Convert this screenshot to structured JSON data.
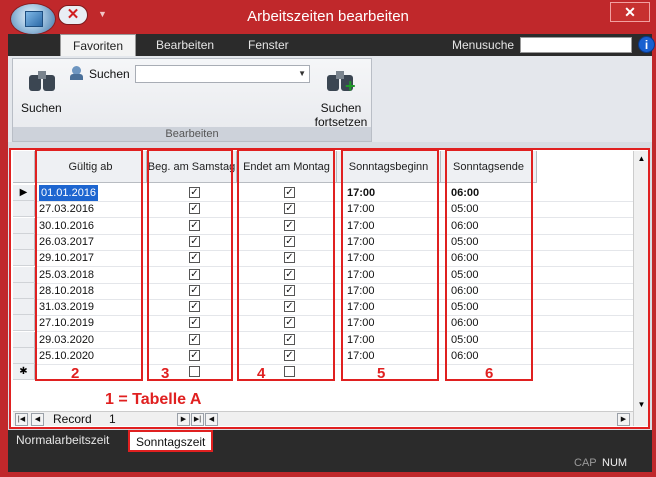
{
  "window": {
    "title": "Arbeitszeiten bearbeiten",
    "close": "✕"
  },
  "ribbon": {
    "tabs": [
      "Favoriten",
      "Bearbeiten",
      "Fenster"
    ],
    "menusuche_label": "Menusuche",
    "help": "i",
    "group": {
      "label": "Bearbeiten",
      "search_big": "Suchen",
      "search_small": "Suchen",
      "search_next": [
        "Suchen",
        "fortsetzen"
      ]
    }
  },
  "grid": {
    "columns": [
      "Gültig ab",
      "Beg. am Samstag",
      "Endet am Montag",
      "Sonntagsbeginn",
      "Sonntagsende"
    ],
    "rows": [
      {
        "valid_from": "01.01.2016",
        "beg_sat": true,
        "end_mon": true,
        "sun_start": "17:00",
        "sun_end": "06:00"
      },
      {
        "valid_from": "27.03.2016",
        "beg_sat": true,
        "end_mon": true,
        "sun_start": "17:00",
        "sun_end": "05:00"
      },
      {
        "valid_from": "30.10.2016",
        "beg_sat": true,
        "end_mon": true,
        "sun_start": "17:00",
        "sun_end": "06:00"
      },
      {
        "valid_from": "26.03.2017",
        "beg_sat": true,
        "end_mon": true,
        "sun_start": "17:00",
        "sun_end": "05:00"
      },
      {
        "valid_from": "29.10.2017",
        "beg_sat": true,
        "end_mon": true,
        "sun_start": "17:00",
        "sun_end": "06:00"
      },
      {
        "valid_from": "25.03.2018",
        "beg_sat": true,
        "end_mon": true,
        "sun_start": "17:00",
        "sun_end": "05:00"
      },
      {
        "valid_from": "28.10.2018",
        "beg_sat": true,
        "end_mon": true,
        "sun_start": "17:00",
        "sun_end": "06:00"
      },
      {
        "valid_from": "31.03.2019",
        "beg_sat": true,
        "end_mon": true,
        "sun_start": "17:00",
        "sun_end": "05:00"
      },
      {
        "valid_from": "27.10.2019",
        "beg_sat": true,
        "end_mon": true,
        "sun_start": "17:00",
        "sun_end": "06:00"
      },
      {
        "valid_from": "29.03.2020",
        "beg_sat": true,
        "end_mon": true,
        "sun_start": "17:00",
        "sun_end": "05:00"
      },
      {
        "valid_from": "25.10.2020",
        "beg_sat": true,
        "end_mon": true,
        "sun_start": "17:00",
        "sun_end": "06:00"
      }
    ],
    "new_row_marker": "✱",
    "current_row_marker": "▶",
    "annotations": [
      "2",
      "3",
      "4",
      "5",
      "6"
    ],
    "table_annotation": "1 = Tabelle A",
    "record_label": "Record",
    "record_value": "1"
  },
  "bottom_tabs": [
    "Normalarbeitszeit",
    "Sonntagszeit"
  ],
  "status": {
    "cap": "CAP",
    "num": "NUM"
  },
  "colors": {
    "annotation": "#e02020",
    "titlebar": "#c0282b"
  }
}
